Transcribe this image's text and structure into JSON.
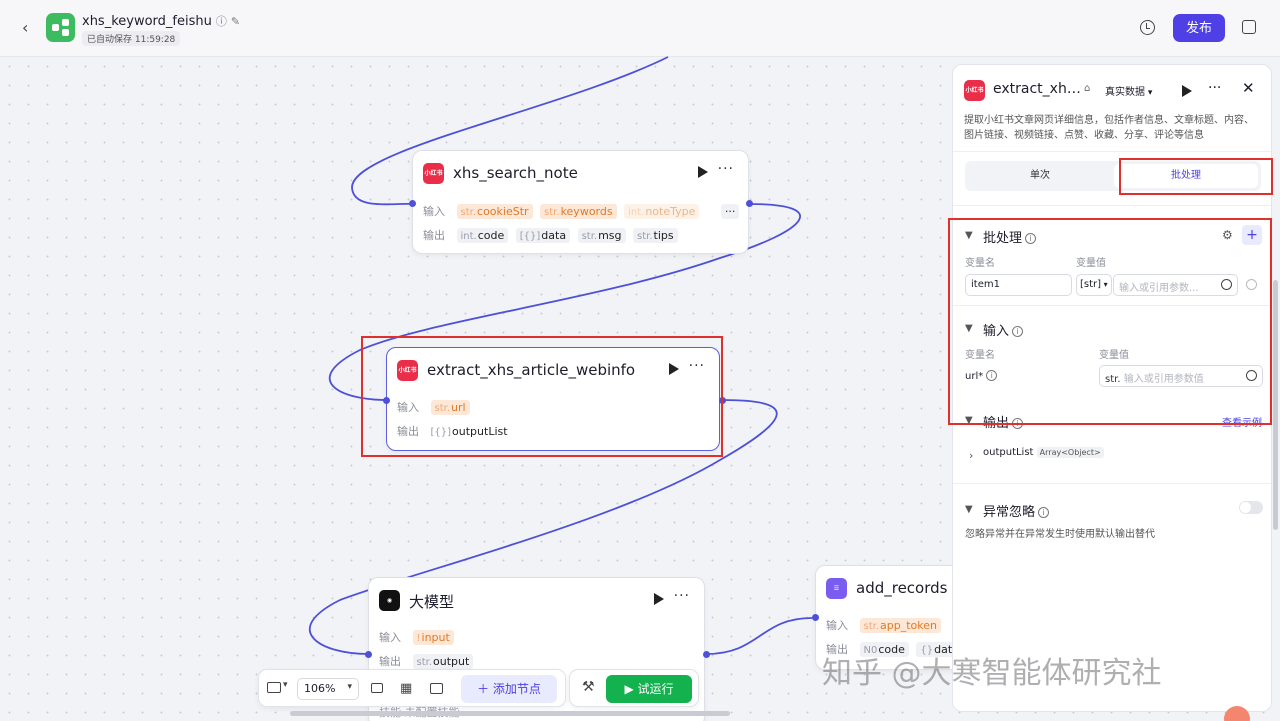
{
  "header": {
    "title": "xhs_keyword_feishu",
    "autosave": "已自动保存 11:59:28",
    "publish": "发布"
  },
  "nodes": {
    "search": {
      "name": "xhs_search_note",
      "in_label": "输入",
      "out_label": "输出",
      "inputs": [
        {
          "type": "str.",
          "name": "cookieStr"
        },
        {
          "type": "str.",
          "name": "keywords"
        },
        {
          "type": "int.",
          "name": "noteType"
        }
      ],
      "outputs": [
        {
          "type": "int.",
          "name": "code"
        },
        {
          "type": "[{}]",
          "name": "data"
        },
        {
          "type": "str.",
          "name": "msg"
        },
        {
          "type": "str.",
          "name": "tips"
        }
      ]
    },
    "extract": {
      "name": "extract_xhs_article_webinfo",
      "in_label": "输入",
      "out_label": "输出",
      "inputs": [
        {
          "type": "str.",
          "name": "url"
        }
      ],
      "outputs": [
        {
          "type": "[{}]",
          "name": "outputList"
        }
      ]
    },
    "llm": {
      "name": "大模型",
      "in_label": "输入",
      "out_label": "输出",
      "skill_row": "技能  未配置技能",
      "inputs": [
        {
          "type": "!",
          "name": "input"
        }
      ],
      "outputs": [
        {
          "type": "str.",
          "name": "output"
        }
      ]
    },
    "records": {
      "name": "add_records",
      "in_label": "输入",
      "out_label": "输出",
      "inputs": [
        {
          "type": "str.",
          "name": "app_token"
        }
      ],
      "outputs": [
        {
          "type": "N0",
          "name": "code"
        },
        {
          "type": "{}",
          "name": "data"
        }
      ]
    }
  },
  "toolbar": {
    "zoom": "106%",
    "add_node": "添加节点",
    "try_run": "试运行"
  },
  "panel": {
    "title": "extract_xh…",
    "data_mode": "真实数据",
    "description": "提取小红书文章网页详细信息，包括作者信息、文章标题、内容、图片链接、视频链接、点赞、收藏、分享、评论等信息",
    "tab_single": "单次",
    "tab_batch": "批处理",
    "batch": {
      "title": "批处理",
      "col_name": "变量名",
      "col_value": "变量值",
      "var_name": "item1",
      "var_type": "[str]",
      "value_placeholder": "输入或引用参数..."
    },
    "input": {
      "title": "输入",
      "col_name": "变量名",
      "col_value": "变量值",
      "param": "url*",
      "param_type": "str.",
      "placeholder": "输入或引用参数值"
    },
    "output": {
      "title": "输出",
      "example_link": "查看示例",
      "item_name": "outputList",
      "item_type": "Array<Object>"
    },
    "exception": {
      "title": "异常忽略",
      "desc": "忽略异常并在异常发生时使用默认输出替代"
    }
  },
  "watermark": "知乎 @大寒智能体研究社",
  "colors": {
    "accent": "#4e40e5",
    "run_green": "#14b14f",
    "wire": "#4e51d8",
    "highlight_box": "#e0302d",
    "xhs_red": "#ea2e49"
  }
}
